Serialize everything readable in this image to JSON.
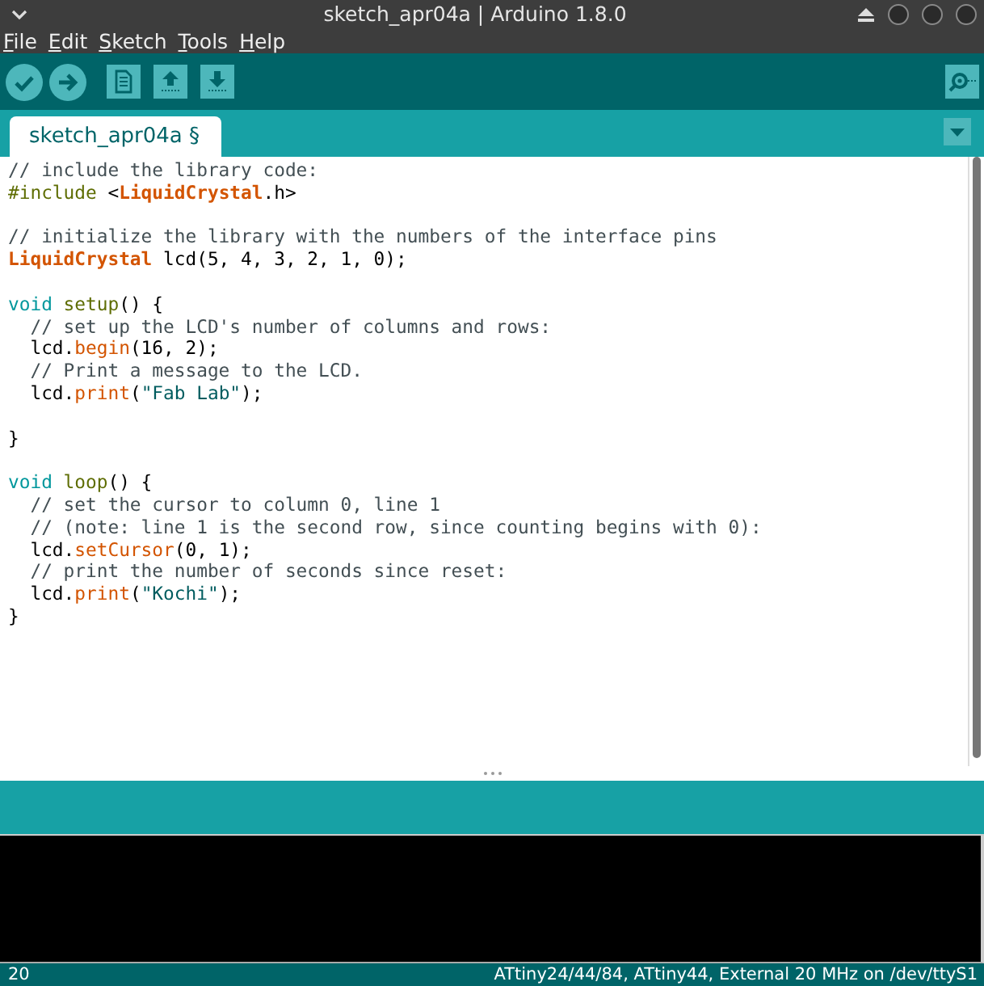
{
  "window": {
    "title": "sketch_apr04a | Arduino 1.8.0"
  },
  "menu": [
    "File",
    "Edit",
    "Sketch",
    "Tools",
    "Help"
  ],
  "tabs": [
    {
      "label": "sketch_apr04a §",
      "selected": true
    }
  ],
  "code": [
    {
      "kind": "code",
      "tokens": [
        {
          "kind": "comment",
          "text": "// include the library code:"
        }
      ]
    },
    {
      "kind": "code",
      "tokens": [
        {
          "kind": "preproc",
          "text": "#include"
        },
        {
          "kind": "plain",
          "text": " <"
        },
        {
          "kind": "type",
          "text": "LiquidCrystal"
        },
        {
          "kind": "plain",
          "text": ".h>"
        }
      ]
    },
    {
      "kind": "blank"
    },
    {
      "kind": "code",
      "tokens": [
        {
          "kind": "comment",
          "text": "// initialize the library with the numbers of the interface pins"
        }
      ]
    },
    {
      "kind": "code",
      "tokens": [
        {
          "kind": "type",
          "text": "LiquidCrystal"
        },
        {
          "kind": "plain",
          "text": " lcd(5, 4, 3, 2, 1, 0);"
        }
      ]
    },
    {
      "kind": "blank"
    },
    {
      "kind": "code",
      "tokens": [
        {
          "kind": "keyword",
          "text": "void "
        },
        {
          "kind": "func",
          "text": "setup"
        },
        {
          "kind": "plain",
          "text": "() {"
        }
      ]
    },
    {
      "kind": "code",
      "tokens": [
        {
          "kind": "comment",
          "text": "  // set up the LCD's number of columns and rows:"
        }
      ]
    },
    {
      "kind": "code",
      "tokens": [
        {
          "kind": "plain",
          "text": "  lcd."
        },
        {
          "kind": "method",
          "text": "begin"
        },
        {
          "kind": "plain",
          "text": "(16, 2);"
        }
      ]
    },
    {
      "kind": "code",
      "tokens": [
        {
          "kind": "comment",
          "text": "  // Print a message to the LCD."
        }
      ]
    },
    {
      "kind": "code",
      "tokens": [
        {
          "kind": "plain",
          "text": "  lcd."
        },
        {
          "kind": "method",
          "text": "print"
        },
        {
          "kind": "plain",
          "text": "("
        },
        {
          "kind": "string",
          "text": "\"Fab Lab\""
        },
        {
          "kind": "plain",
          "text": ");"
        }
      ]
    },
    {
      "kind": "blank"
    },
    {
      "kind": "code",
      "tokens": [
        {
          "kind": "plain",
          "text": "}"
        }
      ]
    },
    {
      "kind": "blank"
    },
    {
      "kind": "code",
      "tokens": [
        {
          "kind": "keyword",
          "text": "void "
        },
        {
          "kind": "func",
          "text": "loop"
        },
        {
          "kind": "plain",
          "text": "() {"
        }
      ]
    },
    {
      "kind": "code",
      "tokens": [
        {
          "kind": "comment",
          "text": "  // set the cursor to column 0, line 1"
        }
      ]
    },
    {
      "kind": "code",
      "tokens": [
        {
          "kind": "comment",
          "text": "  // (note: line 1 is the second row, since counting begins with 0):"
        }
      ]
    },
    {
      "kind": "code",
      "tokens": [
        {
          "kind": "plain",
          "text": "  lcd."
        },
        {
          "kind": "method",
          "text": "setCursor"
        },
        {
          "kind": "plain",
          "text": "(0, 1);"
        }
      ]
    },
    {
      "kind": "code",
      "tokens": [
        {
          "kind": "comment",
          "text": "  // print the number of seconds since reset:"
        }
      ]
    },
    {
      "kind": "code",
      "tokens": [
        {
          "kind": "plain",
          "text": "  lcd."
        },
        {
          "kind": "method",
          "text": "print"
        },
        {
          "kind": "plain",
          "text": "("
        },
        {
          "kind": "string",
          "text": "\"Kochi\""
        },
        {
          "kind": "plain",
          "text": ");"
        }
      ]
    },
    {
      "kind": "code",
      "tokens": [
        {
          "kind": "plain",
          "text": "}"
        }
      ]
    }
  ],
  "status_bar": {
    "line": "20",
    "board": "ATtiny24/44/84, ATtiny44, External 20 MHz on /dev/ttyS1"
  }
}
